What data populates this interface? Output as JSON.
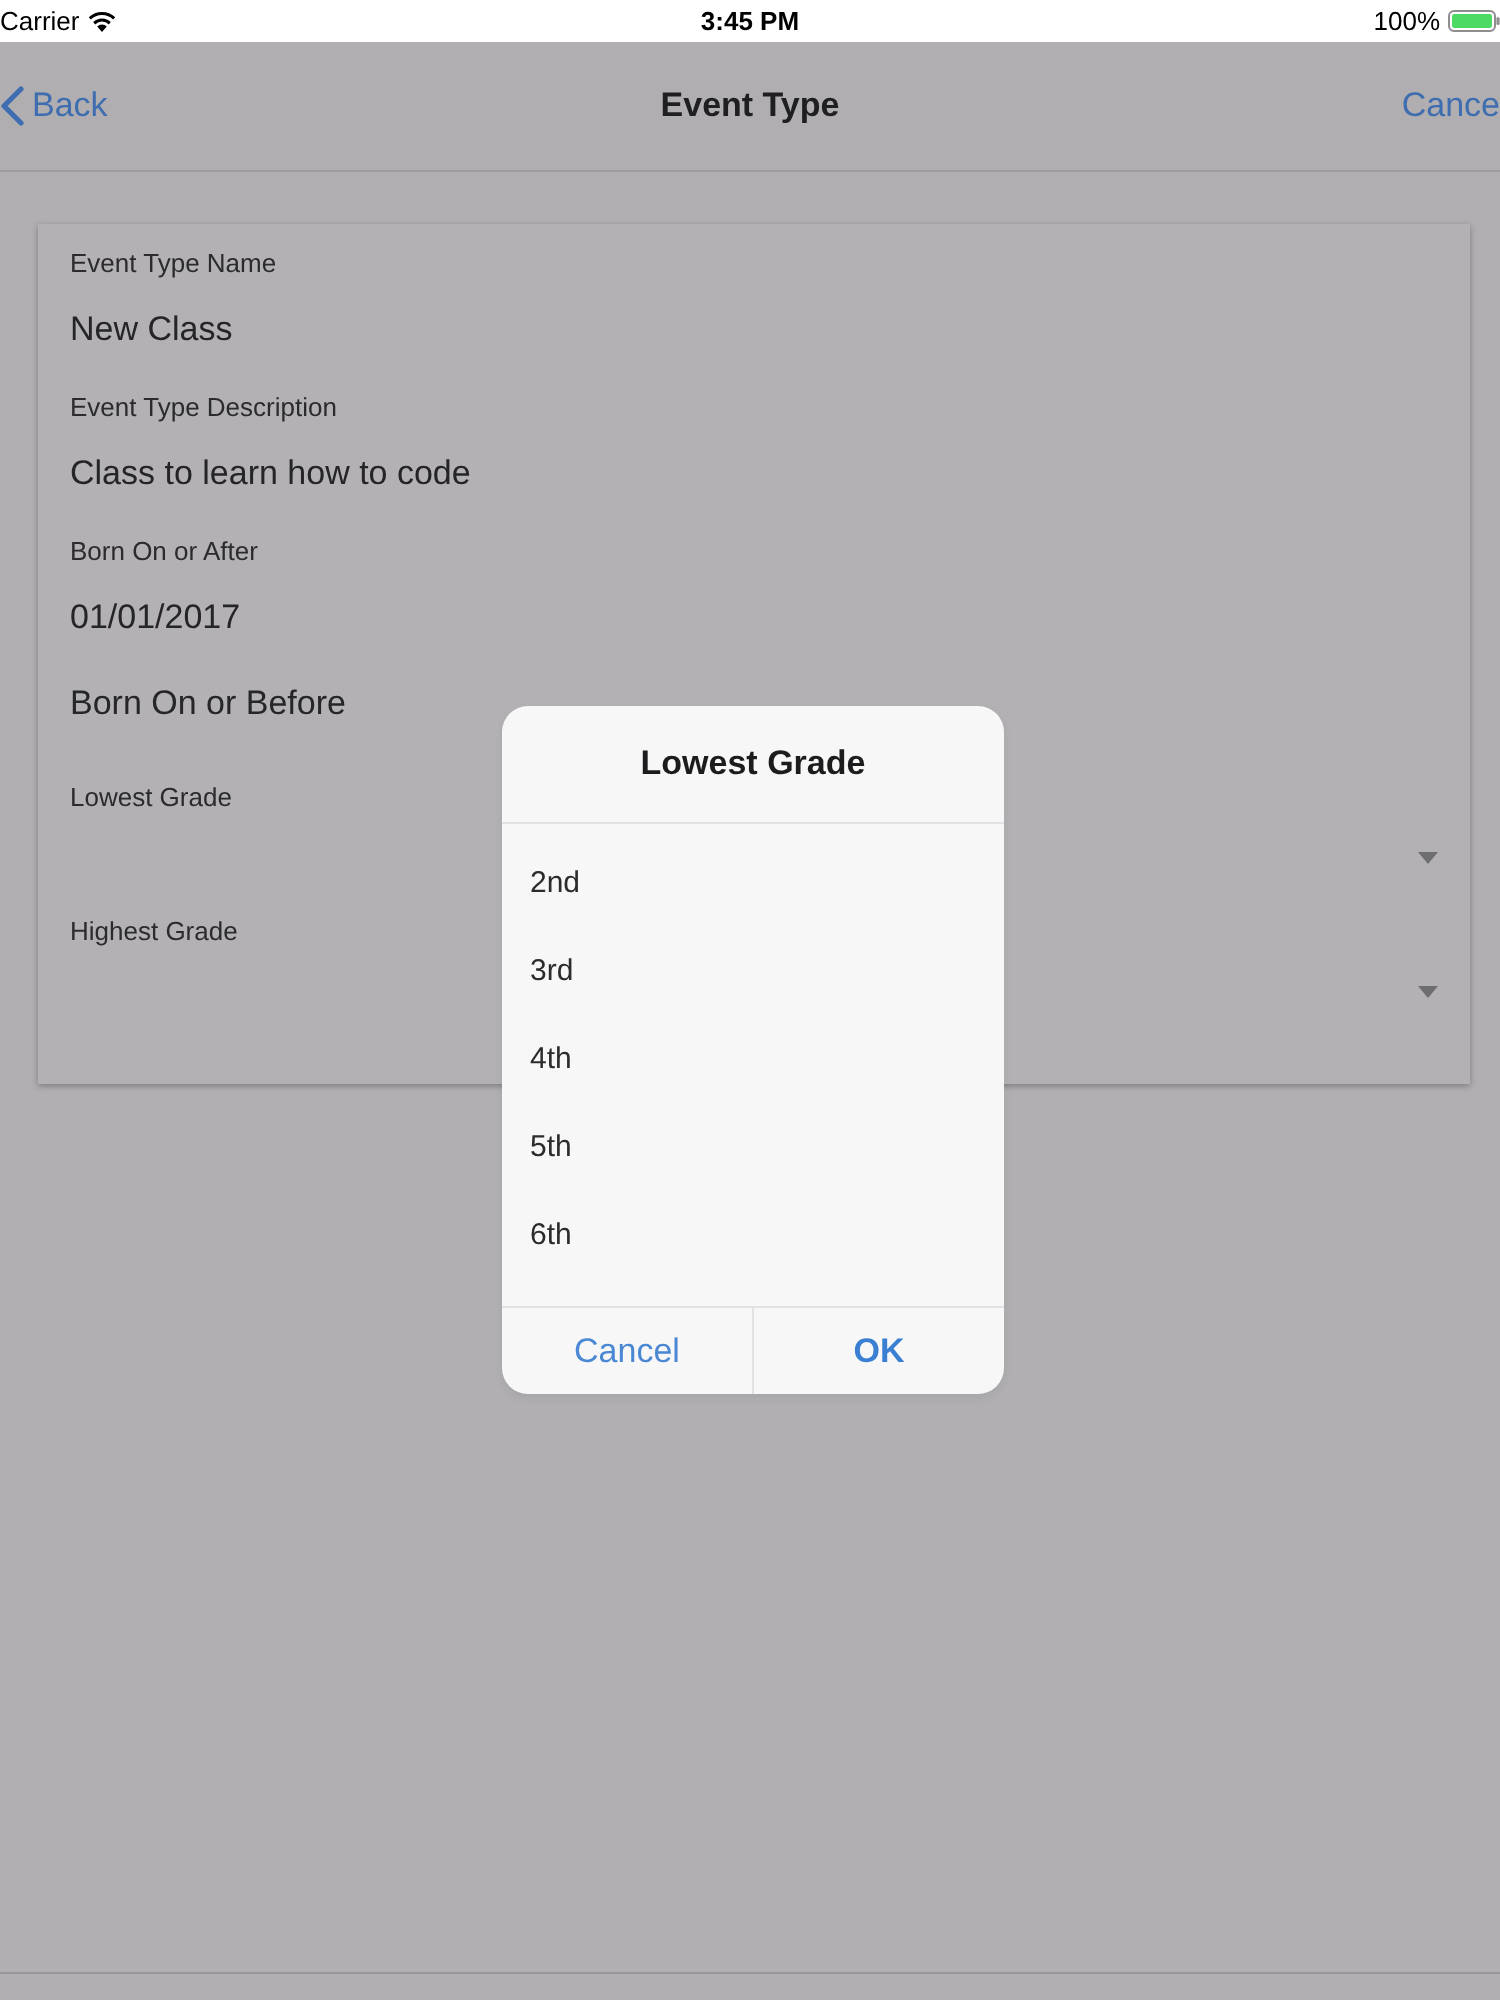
{
  "status_bar": {
    "carrier": "Carrier",
    "time": "3:45 PM",
    "battery": "100%"
  },
  "nav_bar": {
    "back": "Back",
    "title": "Event Type",
    "right_button": "Cance"
  },
  "form": {
    "fields": [
      {
        "kind": "text",
        "label": "Event Type Name",
        "value": "New Class"
      },
      {
        "kind": "text",
        "label": "Event Type Description",
        "value": "Class to learn how to code"
      },
      {
        "kind": "text",
        "label": "Born On or After",
        "value": "01/01/2017"
      },
      {
        "kind": "date",
        "placeholder": "Born On or Before"
      },
      {
        "kind": "select",
        "label": "Lowest Grade"
      },
      {
        "kind": "select",
        "label": "Highest Grade"
      }
    ]
  },
  "dialog": {
    "title": "Lowest Grade",
    "options": [
      {
        "label": "2nd",
        "selected": false
      },
      {
        "label": "3rd",
        "selected": false
      },
      {
        "label": "4th",
        "selected": false
      },
      {
        "label": "5th",
        "selected": false
      },
      {
        "label": "6th",
        "selected": false
      }
    ],
    "buttons": [
      {
        "kind": "cancel",
        "label": "Cancel"
      },
      {
        "kind": "confirm",
        "label": "OK"
      }
    ]
  }
}
